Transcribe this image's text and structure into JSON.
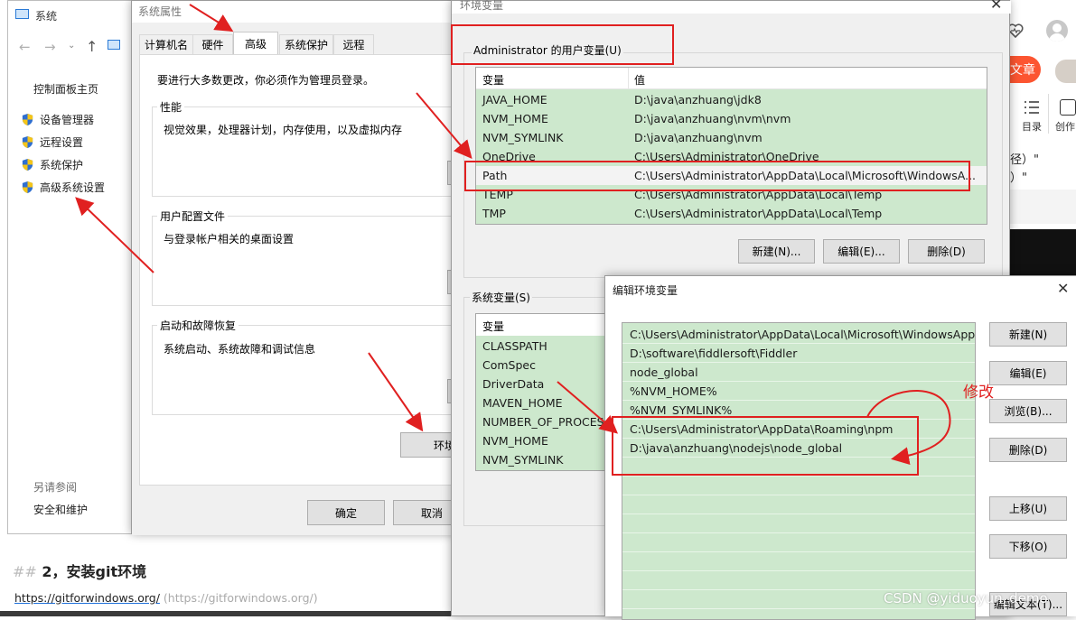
{
  "system_window": {
    "title": "系统",
    "nav": {
      "back": "←",
      "forward": "→",
      "up": "↑"
    },
    "control_panel_home": "控制面板主页",
    "links": [
      "设备管理器",
      "远程设置",
      "系统保护",
      "高级系统设置"
    ],
    "see_also": "另请参阅",
    "security": "安全和维护"
  },
  "sysprops": {
    "title": "系统属性",
    "tabs": [
      "计算机名",
      "硬件",
      "高级",
      "系统保护",
      "远程"
    ],
    "notice": "要进行大多数更改，你必须作为管理员登录。",
    "performance": {
      "title": "性能",
      "desc": "视觉效果，处理器计划，内存使用，以及虚拟内存"
    },
    "profile": {
      "title": "用户配置文件",
      "desc": "与登录帐户相关的桌面设置"
    },
    "startup": {
      "title": "启动和故障恢复",
      "desc": "系统启动、系统故障和调试信息"
    },
    "env_button": "环境",
    "ok": "确定",
    "cancel": "取消"
  },
  "envvars": {
    "title": "环境变量",
    "user_group": "Administrator 的用户变量(U)",
    "col_var": "变量",
    "col_val": "值",
    "user_vars": [
      {
        "name": "JAVA_HOME",
        "value": "D:\\java\\anzhuang\\jdk8"
      },
      {
        "name": "NVM_HOME",
        "value": "D:\\java\\anzhuang\\nvm\\nvm"
      },
      {
        "name": "NVM_SYMLINK",
        "value": "D:\\java\\anzhuang\\nvm"
      },
      {
        "name": "OneDrive",
        "value": "C:\\Users\\Administrator\\OneDrive"
      },
      {
        "name": "Path",
        "value": "C:\\Users\\Administrator\\AppData\\Local\\Microsoft\\WindowsA..."
      },
      {
        "name": "TEMP",
        "value": "C:\\Users\\Administrator\\AppData\\Local\\Temp"
      },
      {
        "name": "TMP",
        "value": "C:\\Users\\Administrator\\AppData\\Local\\Temp"
      }
    ],
    "new": "新建(N)...",
    "edit": "编辑(E)...",
    "delete": "删除(D)",
    "sys_group": "系统变量(S)",
    "sys_vars": [
      "CLASSPATH",
      "ComSpec",
      "DriverData",
      "MAVEN_HOME",
      "NUMBER_OF_PROCESS",
      "NVM_HOME",
      "NVM_SYMLINK"
    ]
  },
  "editenv": {
    "title": "编辑环境变量",
    "entries": [
      "C:\\Users\\Administrator\\AppData\\Local\\Microsoft\\WindowsApps",
      "D:\\software\\fiddlersoft\\Fiddler",
      "node_global",
      "%NVM_HOME%",
      "%NVM_SYMLINK%",
      "C:\\Users\\Administrator\\AppData\\Roaming\\npm",
      "D:\\java\\anzhuang\\nodejs\\node_global"
    ],
    "buttons": {
      "new": "新建(N)",
      "edit": "编辑(E)",
      "browse": "浏览(B)...",
      "delete": "删除(D)",
      "up": "上移(U)",
      "down": "下移(O)",
      "edit_text": "编辑文本(T)..."
    },
    "annotation": "修改"
  },
  "background": {
    "heading_marks": "##",
    "heading": "2，安装git环境",
    "link": "https://gitforwindows.org/",
    "link_suffix": "(https://gitforwindows.org/)",
    "right_text1": "径）\"",
    "right_text2": "）\"",
    "catalog": "目录",
    "create": "创作",
    "article_btn": "文章",
    "bottom_text": "安"
  },
  "watermark": "CSDN @yiduoyun_demo",
  "colors": {
    "list_green": "#cde8cd",
    "highlight_red": "#e02020",
    "selected_row": "#f3f3f3"
  }
}
